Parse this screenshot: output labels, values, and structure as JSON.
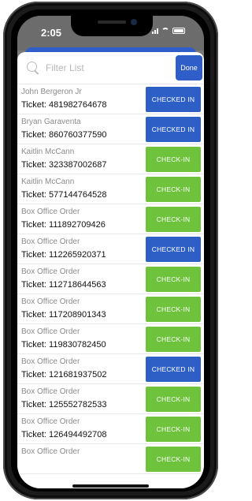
{
  "status": {
    "time": "2:05"
  },
  "search": {
    "placeholder": "Filter List",
    "done_label": "Done"
  },
  "colors": {
    "checked_in": "#2e5fc6",
    "check_in": "#6ec23c",
    "accent": "#2f5ec8"
  },
  "rows": [
    {
      "name": "John Bergeron Jr",
      "ticket": "Ticket: 481982764678",
      "status": "CHECKED IN",
      "state": "checked"
    },
    {
      "name": "Bryan Garaventa",
      "ticket": "Ticket: 860760377590",
      "status": "CHECKED IN",
      "state": "checked"
    },
    {
      "name": "Kaitlin McCann",
      "ticket": "Ticket: 323387002687",
      "status": "CHECK-IN",
      "state": "checkin"
    },
    {
      "name": "Kaitlin McCann",
      "ticket": "Ticket: 577144764528",
      "status": "CHECK-IN",
      "state": "checkin"
    },
    {
      "name": "Box Office Order",
      "ticket": "Ticket: 111892709426",
      "status": "CHECK-IN",
      "state": "checkin"
    },
    {
      "name": "Box Office Order",
      "ticket": "Ticket: 112265920371",
      "status": "CHECKED IN",
      "state": "checked"
    },
    {
      "name": "Box Office Order",
      "ticket": "Ticket: 112718644563",
      "status": "CHECK-IN",
      "state": "checkin"
    },
    {
      "name": "Box Office Order",
      "ticket": "Ticket: 117208901343",
      "status": "CHECK-IN",
      "state": "checkin"
    },
    {
      "name": "Box Office Order",
      "ticket": "Ticket: 119830782450",
      "status": "CHECK-IN",
      "state": "checkin"
    },
    {
      "name": "Box Office Order",
      "ticket": "Ticket: 121681937502",
      "status": "CHECKED IN",
      "state": "checked"
    },
    {
      "name": "Box Office Order",
      "ticket": "Ticket: 125552782533",
      "status": "CHECK-IN",
      "state": "checkin"
    },
    {
      "name": "Box Office Order",
      "ticket": "Ticket: 126494492708",
      "status": "CHECK-IN",
      "state": "checkin"
    },
    {
      "name": "Box Office Order",
      "ticket": "",
      "status": "CHECK-IN",
      "state": "checkin"
    }
  ]
}
